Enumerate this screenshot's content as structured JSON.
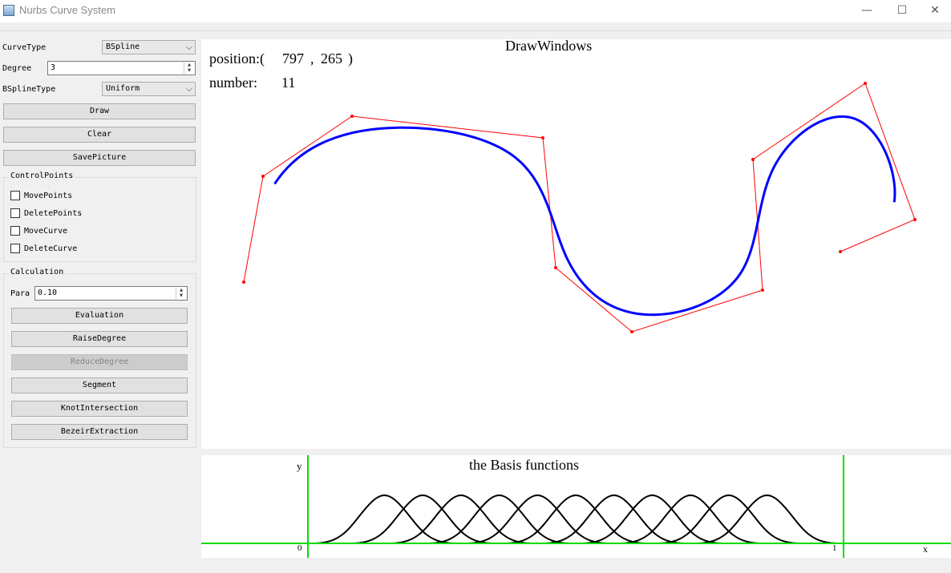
{
  "window": {
    "title": "Nurbs Curve System",
    "controls": [
      "—",
      "☐",
      "✕"
    ]
  },
  "left_panel": {
    "curve_type": {
      "label": "CurveType",
      "value": "BSpline"
    },
    "degree": {
      "label": "Degree",
      "value": "3"
    },
    "bspline_type": {
      "label": "BSplineType",
      "value": "Uniform"
    },
    "buttons": {
      "draw": "Draw",
      "clear": "Clear",
      "save_picture": "SavePicture"
    },
    "control_points": {
      "title": "ControlPoints",
      "move_points": "MovePoints",
      "delete_points": "DeletePoints",
      "move_curve": "MoveCurve",
      "delete_curve": "DeleteCurve"
    },
    "calculation": {
      "title": "Calculation",
      "para_label": "Para",
      "para_value": "0.10",
      "evaluation": "Evaluation",
      "raise_degree": "RaiseDegree",
      "reduce_degree": "ReduceDegree",
      "segment": "Segment",
      "knot_intersection": "KnotIntersection",
      "bezier_extraction": "BezeirExtraction"
    }
  },
  "draw_window": {
    "title": "DrawWindows",
    "position_label": "position:(",
    "position_x": "797",
    "position_y": "265",
    "position_close": ")",
    "number_label": "number:",
    "number_value": "11",
    "polygon_color": "#ff0000",
    "curve_color": "#0000ff",
    "control_points": [
      [
        304,
        352
      ],
      [
        328,
        220
      ],
      [
        439,
        145
      ],
      [
        677,
        172
      ],
      [
        693,
        334
      ],
      [
        788,
        414
      ],
      [
        951,
        362
      ],
      [
        939,
        199
      ],
      [
        1079,
        104
      ],
      [
        1141,
        274
      ],
      [
        1048,
        314
      ]
    ]
  },
  "basis_window": {
    "title": "the Basis functions",
    "y_label": "y",
    "x_label": "x",
    "origin_label": "0",
    "one_label": "1",
    "axis_color": "#00dd00"
  }
}
